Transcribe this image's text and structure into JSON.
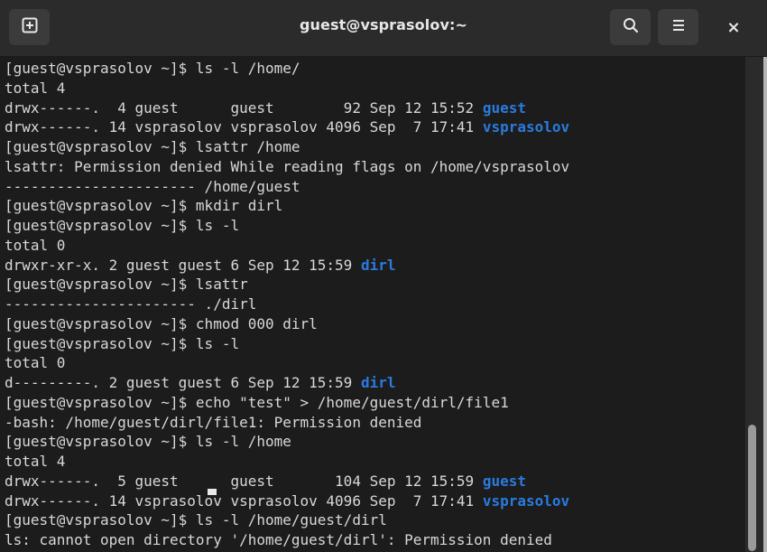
{
  "window": {
    "title": "guest@vsprasolov:~"
  },
  "icons": {
    "new_tab": "new-tab-icon",
    "search": "search-icon",
    "menu": "hamburger-menu-icon",
    "close": "close-icon",
    "close_glyph": "×"
  },
  "colors": {
    "titlebar": "#2b2b2b",
    "terminal_bg": "#1c1c1c",
    "text": "#d8d8d8",
    "directory": "#2a7bde"
  },
  "terminal": {
    "lines": [
      {
        "text": "[guest@vsprasolov ~]$ ls -l /home/"
      },
      {
        "text": "total 4"
      },
      {
        "text": "drwx------.  4 guest      guest        92 Sep 12 15:52 ",
        "dir": "guest"
      },
      {
        "text": "drwx------. 14 vsprasolov vsprasolov 4096 Sep  7 17:41 ",
        "dir": "vsprasolov"
      },
      {
        "text": "[guest@vsprasolov ~]$ lsattr /home"
      },
      {
        "text": "lsattr: Permission denied While reading flags on /home/vsprasolov"
      },
      {
        "text": "---------------------- /home/guest"
      },
      {
        "text": "[guest@vsprasolov ~]$ mkdir dirl"
      },
      {
        "text": "[guest@vsprasolov ~]$ ls -l"
      },
      {
        "text": "total 0"
      },
      {
        "text": "drwxr-xr-x. 2 guest guest 6 Sep 12 15:59 ",
        "dir": "dirl"
      },
      {
        "text": "[guest@vsprasolov ~]$ lsattr"
      },
      {
        "text": "---------------------- ./dirl"
      },
      {
        "text": "[guest@vsprasolov ~]$ chmod 000 dirl"
      },
      {
        "text": "[guest@vsprasolov ~]$ ls -l"
      },
      {
        "text": "total 0"
      },
      {
        "text": "d---------. 2 guest guest 6 Sep 12 15:59 ",
        "dir": "dirl"
      },
      {
        "text": "[guest@vsprasolov ~]$ echo \"test\" > /home/guest/dirl/file1"
      },
      {
        "text": "-bash: /home/guest/dirl/file1: Permission denied"
      },
      {
        "text": "[guest@vsprasolov ~]$ ls -l /home"
      },
      {
        "text": "total 4"
      },
      {
        "text": "drwx------.  5 guest      guest       104 Sep 12 15:59 ",
        "dir": "guest"
      },
      {
        "text": "drwx------. 14 vsprasolov vsprasolov 4096 Sep  7 17:41 ",
        "dir": "vsprasolov"
      },
      {
        "text": "[guest@vsprasolov ~]$ ls -l /home/guest/dirl"
      },
      {
        "text": "ls: cannot open directory '/home/guest/dirl': Permission denied"
      }
    ]
  }
}
